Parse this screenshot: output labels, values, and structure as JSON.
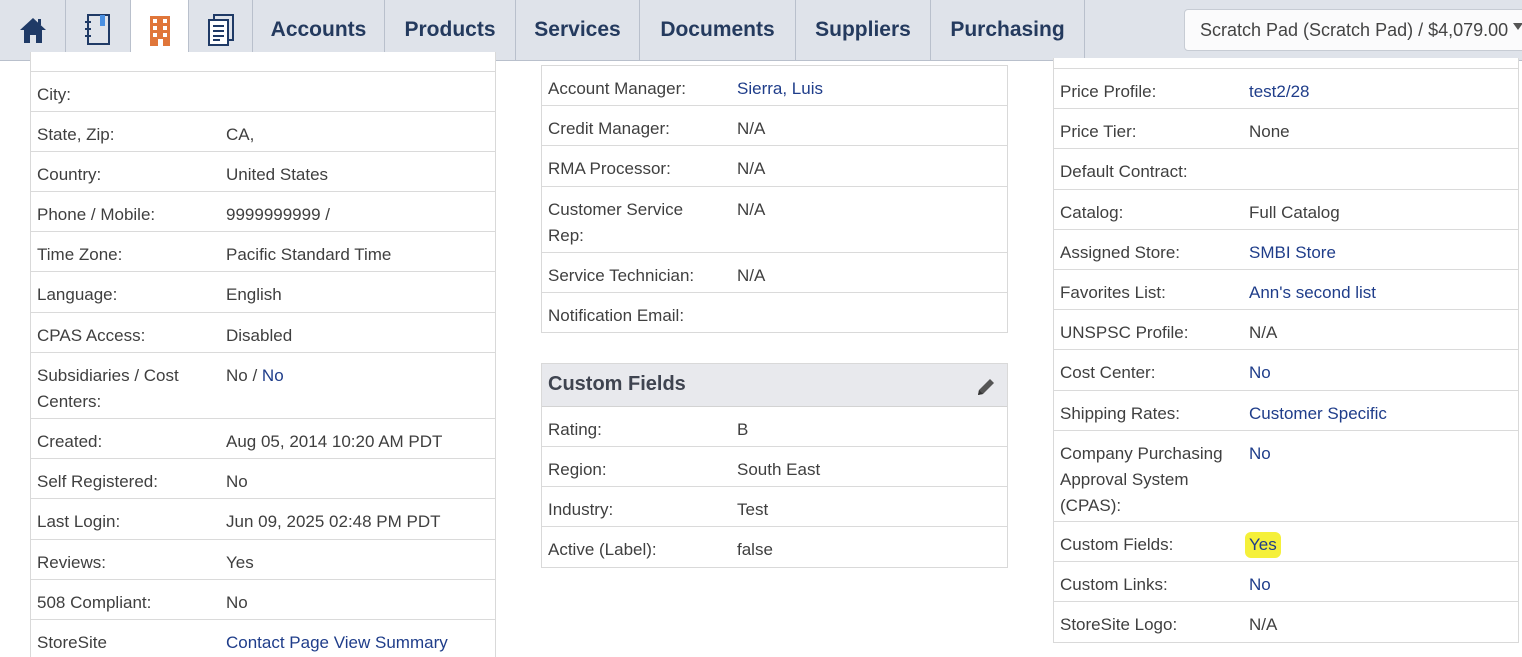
{
  "nav": {
    "home_icon": "home-icon",
    "notebook_icon": "notebook-icon",
    "building_icon": "building-icon",
    "document_icon": "document-icon",
    "tabs": [
      "Accounts",
      "Products",
      "Services",
      "Documents",
      "Suppliers",
      "Purchasing"
    ],
    "scratch_pad": "Scratch Pad (Scratch Pad) / $4,079.00",
    "active_color": "#e0763a"
  },
  "left": [
    {
      "label": "City:",
      "value": ""
    },
    {
      "label": "State, Zip:",
      "value": "CA,"
    },
    {
      "label": "Country:",
      "value": "United States"
    },
    {
      "label": "Phone / Mobile:",
      "value": "9999999999 /"
    },
    {
      "label": "Time Zone:",
      "value": "Pacific Standard Time"
    },
    {
      "label": "Language:",
      "value": "English"
    },
    {
      "label": "CPAS Access:",
      "value": "Disabled"
    },
    {
      "label": "Subsidiaries / Cost",
      "label2": "Centers:",
      "value": "No /",
      "value_link": "No"
    },
    {
      "label": "Created:",
      "value": "Aug 05, 2014 10:20 AM PDT"
    },
    {
      "label": "Self Registered:",
      "value": "No"
    },
    {
      "label": "Last Login:",
      "value": "Jun 09, 2025 02:48 PM PDT"
    },
    {
      "label": "Reviews:",
      "value": "Yes"
    },
    {
      "label": "508 Compliant:",
      "value": "No"
    },
    {
      "label": "StoreSite",
      "value_link": "Contact Page View Summary"
    }
  ],
  "middle": [
    {
      "label": "Account Manager:",
      "value_link": "Sierra, Luis"
    },
    {
      "label": "Credit Manager:",
      "value": "N/A"
    },
    {
      "label": "RMA Processor:",
      "value": "N/A"
    },
    {
      "label": "Customer Service",
      "label2": "Rep:",
      "value": "N/A"
    },
    {
      "label": "Service Technician:",
      "value": "N/A"
    },
    {
      "label": "Notification Email:",
      "value": ""
    }
  ],
  "custom_fields": {
    "title": "Custom Fields",
    "edit_icon": "pencil-icon",
    "rows": [
      {
        "label": "Rating:",
        "value": "B"
      },
      {
        "label": "Region:",
        "value": "South East"
      },
      {
        "label": "Industry:",
        "value": "Test"
      },
      {
        "label": "Active (Label):",
        "value": "false"
      }
    ]
  },
  "right": [
    {
      "label": "Price Profile:",
      "value_link": "test2/28"
    },
    {
      "label": "Price Tier:",
      "value": "None"
    },
    {
      "label": "Default Contract:",
      "value": ""
    },
    {
      "label": "Catalog:",
      "value": "Full Catalog"
    },
    {
      "label": "Assigned Store:",
      "value_link": "SMBI Store"
    },
    {
      "label": "Favorites List:",
      "value_link": "Ann's second list"
    },
    {
      "label": "UNSPSC Profile:",
      "value": "N/A"
    },
    {
      "label": "Cost Center:",
      "value_link": "No"
    },
    {
      "label": "Shipping Rates:",
      "value_link": "Customer Specific"
    },
    {
      "label": "Company Purchasing",
      "label2": "Approval System",
      "label3": "(CPAS):",
      "value_link": "No"
    },
    {
      "label": "Custom Fields:",
      "value_link": "Yes",
      "highlight_color": "#f5f03a"
    },
    {
      "label": "Custom Links:",
      "value_link": "No"
    },
    {
      "label": "StoreSite Logo:",
      "value": "N/A"
    }
  ]
}
